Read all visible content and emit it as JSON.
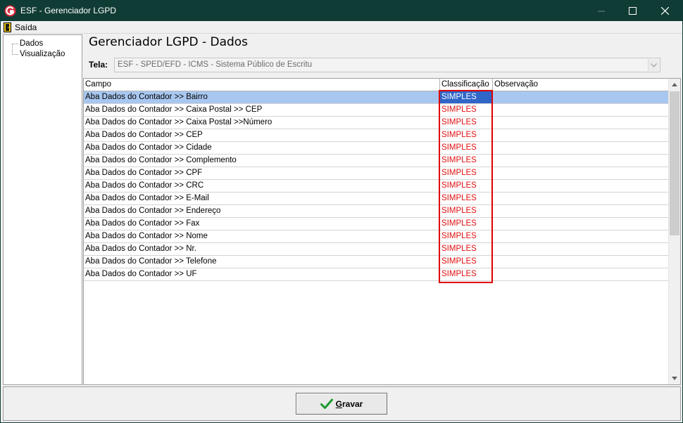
{
  "window": {
    "title": "ESF - Gerenciador LGPD",
    "app_icon": "esf-logo-icon",
    "controls": [
      "minimize-icon",
      "maximize-icon",
      "close-icon"
    ]
  },
  "menu": {
    "exit_label": "Saída",
    "exit_icon": "door-exit-icon"
  },
  "tree": {
    "items": [
      {
        "label": "Dados"
      },
      {
        "label": "Visualização"
      }
    ]
  },
  "page": {
    "title": "Gerenciador LGPD - Dados"
  },
  "tela": {
    "label": "Tela:",
    "value": "ESF - SPED/EFD - ICMS - Sistema Público de Escritu"
  },
  "grid": {
    "columns": [
      "Campo",
      "Classificação",
      "Observação"
    ],
    "selected_row": 0,
    "rows": [
      {
        "campo": "Aba Dados do Contador >> Bairro",
        "classificacao": "SIMPLES",
        "observacao": ""
      },
      {
        "campo": "Aba Dados do Contador >> Caixa Postal >> CEP",
        "classificacao": "SIMPLES",
        "observacao": ""
      },
      {
        "campo": "Aba Dados do Contador >> Caixa Postal >>Número",
        "classificacao": "SIMPLES",
        "observacao": ""
      },
      {
        "campo": "Aba Dados do Contador >> CEP",
        "classificacao": "SIMPLES",
        "observacao": ""
      },
      {
        "campo": "Aba Dados do Contador >> Cidade",
        "classificacao": "SIMPLES",
        "observacao": ""
      },
      {
        "campo": "Aba Dados do Contador >> Complemento",
        "classificacao": "SIMPLES",
        "observacao": ""
      },
      {
        "campo": "Aba Dados do Contador >> CPF",
        "classificacao": "SIMPLES",
        "observacao": ""
      },
      {
        "campo": "Aba Dados do Contador >> CRC",
        "classificacao": "SIMPLES",
        "observacao": ""
      },
      {
        "campo": "Aba Dados do Contador >> E-Mail",
        "classificacao": "SIMPLES",
        "observacao": ""
      },
      {
        "campo": "Aba Dados do Contador >> Endereço",
        "classificacao": "SIMPLES",
        "observacao": ""
      },
      {
        "campo": "Aba Dados do Contador >> Fax",
        "classificacao": "SIMPLES",
        "observacao": ""
      },
      {
        "campo": "Aba Dados do Contador >> Nome",
        "classificacao": "SIMPLES",
        "observacao": ""
      },
      {
        "campo": "Aba Dados do Contador >> Nr.",
        "classificacao": "SIMPLES",
        "observacao": ""
      },
      {
        "campo": "Aba Dados do Contador >> Telefone",
        "classificacao": "SIMPLES",
        "observacao": ""
      },
      {
        "campo": "Aba Dados do Contador >> UF",
        "classificacao": "SIMPLES",
        "observacao": ""
      }
    ]
  },
  "actions": {
    "save_label": "Gravar",
    "save_icon": "checkmark-icon"
  },
  "colors": {
    "titlebar": "#103c36",
    "classification_text": "#e01010",
    "selected_row": "#a8c7f0",
    "selected_cell": "#2f66c8",
    "highlight_box": "#e00000"
  }
}
